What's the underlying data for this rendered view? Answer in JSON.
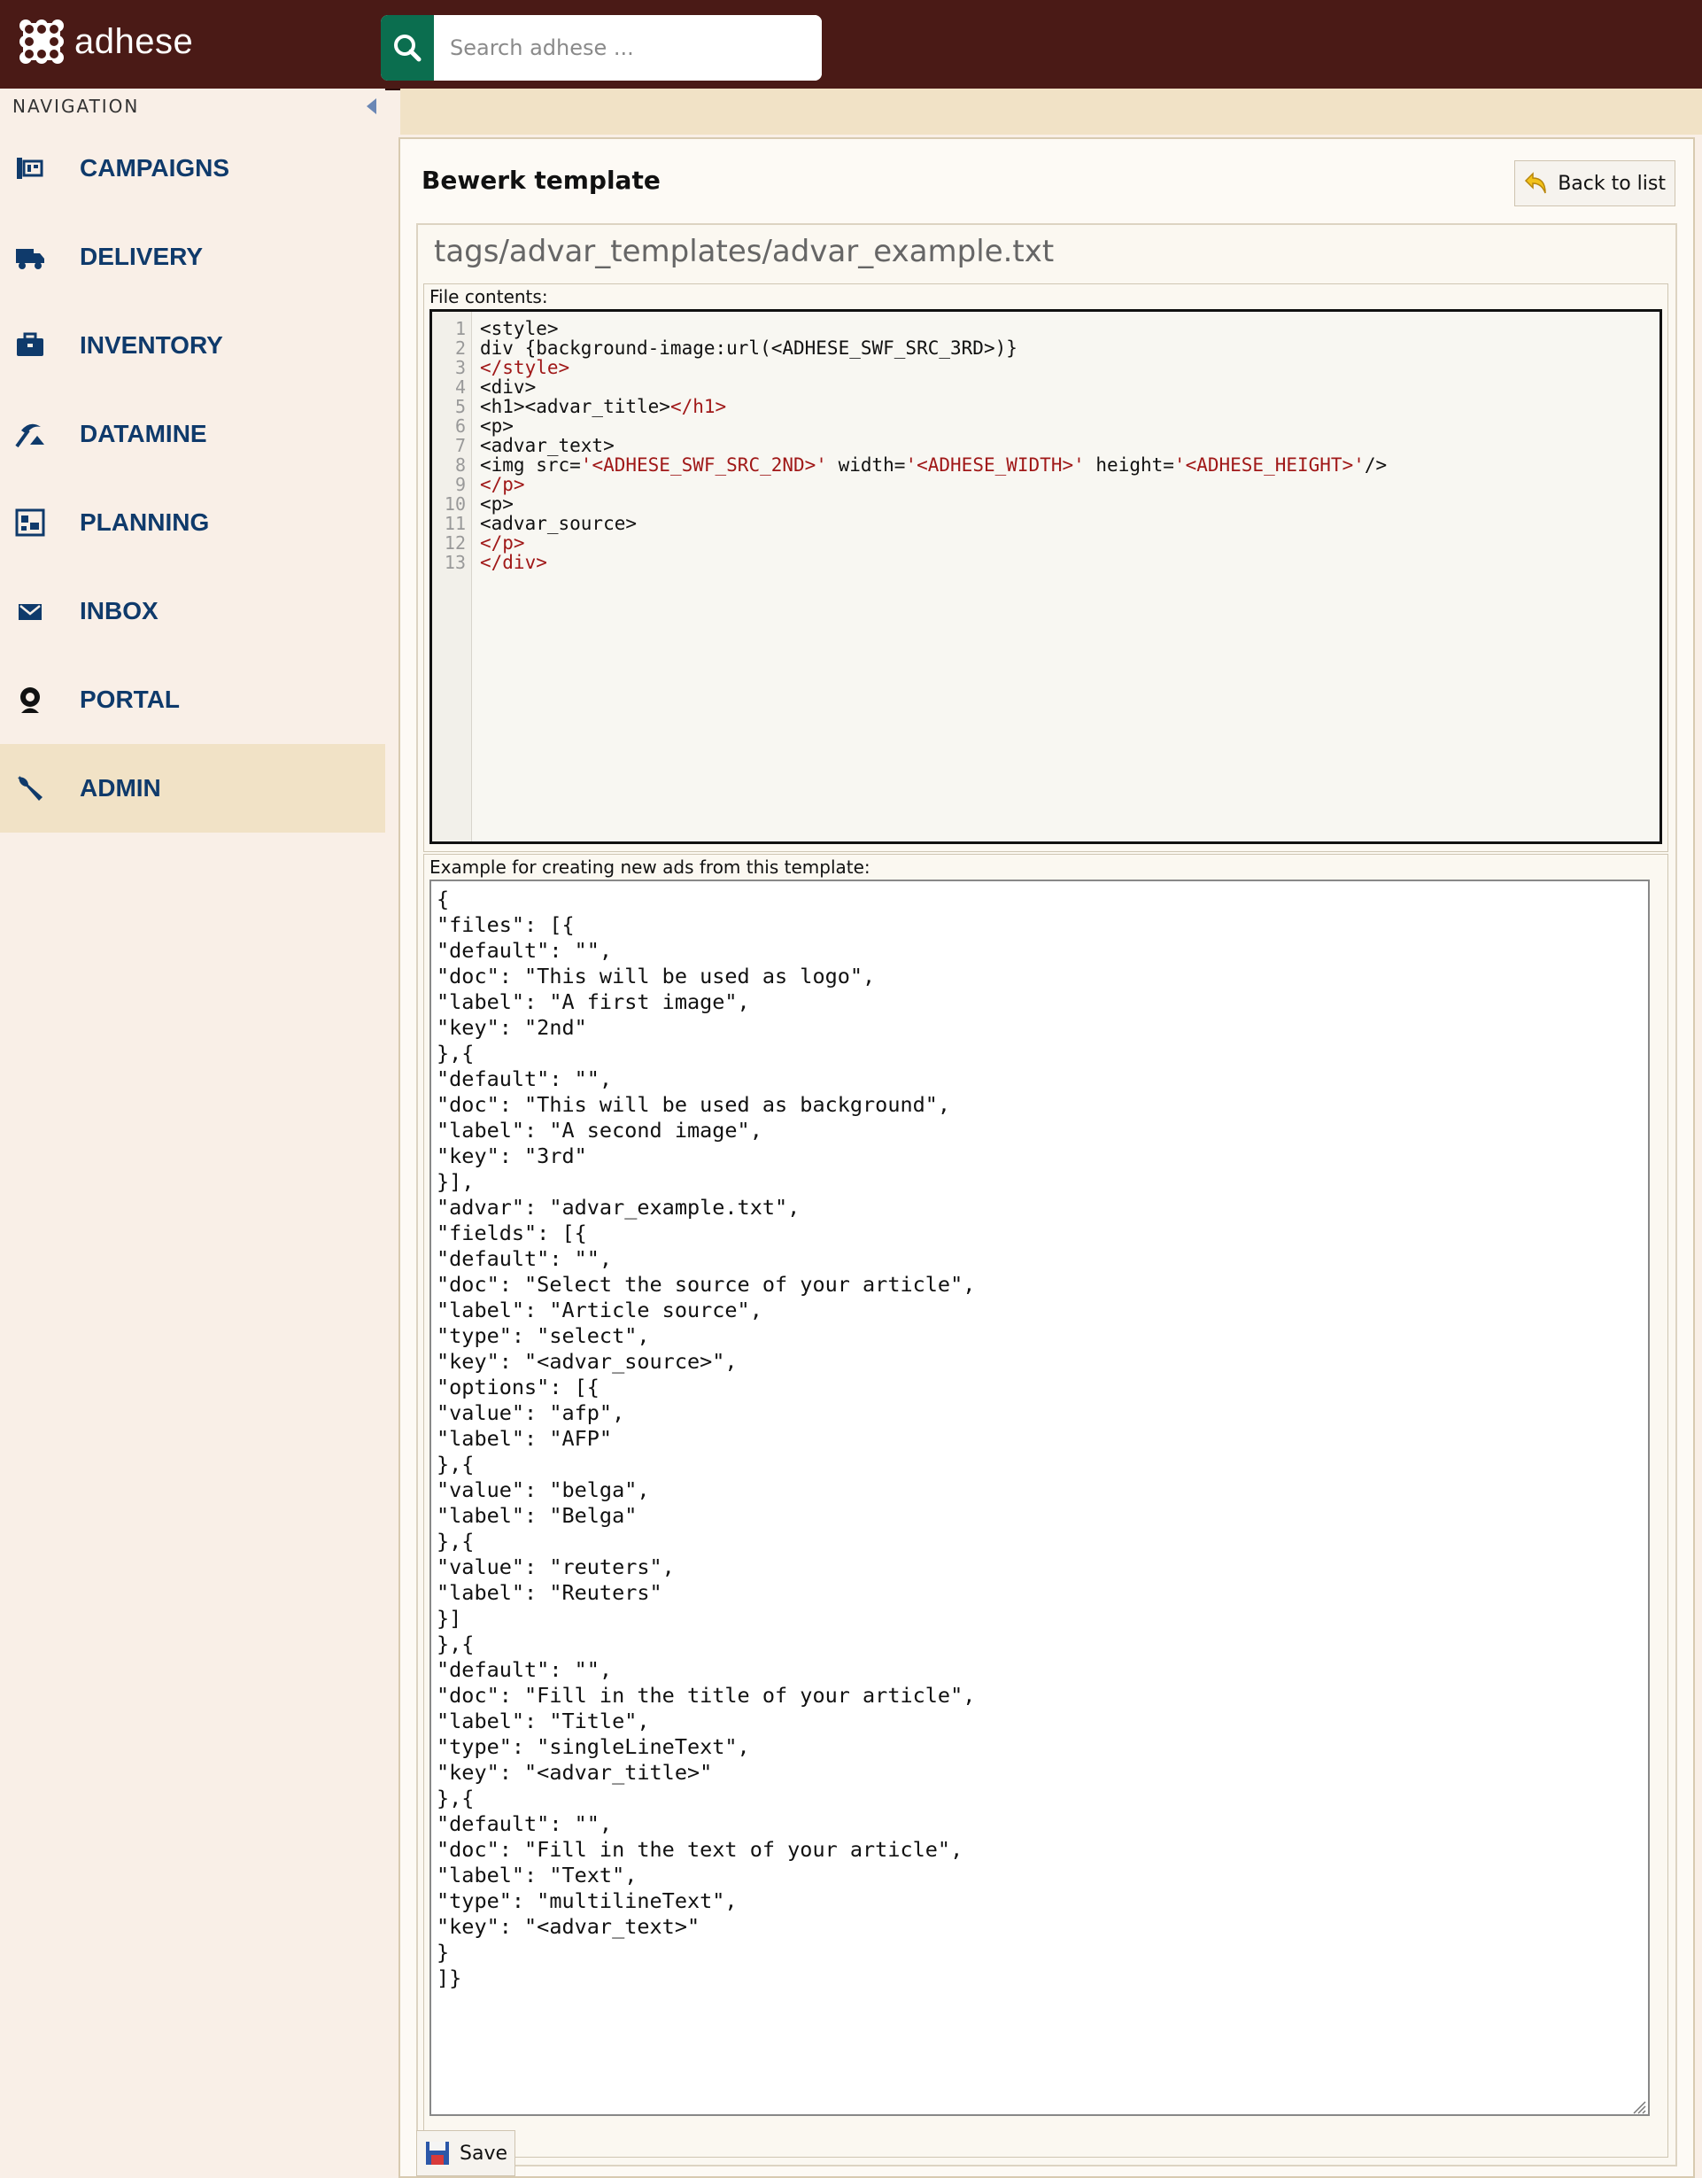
{
  "app": {
    "name": "adhese"
  },
  "search": {
    "placeholder": "Search adhese ..."
  },
  "sidebar": {
    "heading": "NAVIGATION",
    "items": [
      {
        "label": "CAMPAIGNS",
        "icon": "campaigns-icon"
      },
      {
        "label": "DELIVERY",
        "icon": "truck-icon"
      },
      {
        "label": "INVENTORY",
        "icon": "briefcase-icon"
      },
      {
        "label": "DATAMINE",
        "icon": "pickaxe-icon"
      },
      {
        "label": "PLANNING",
        "icon": "planning-icon"
      },
      {
        "label": "INBOX",
        "icon": "mail-icon"
      },
      {
        "label": "PORTAL",
        "icon": "webcam-icon"
      },
      {
        "label": "ADMIN",
        "icon": "wrench-icon",
        "active": true
      }
    ]
  },
  "page": {
    "title": "Bewerk template",
    "back_label": "Back to list",
    "file_path": "tags/advar_templates/advar_example.txt",
    "file_contents_label": "File contents:",
    "example_label": "Example for creating new ads from this template:",
    "save_label": "Save"
  },
  "code": {
    "line_numbers": [
      "1",
      "2",
      "3",
      "4",
      "5",
      "6",
      "7",
      "8",
      "9",
      "10",
      "11",
      "12",
      "13"
    ],
    "l1": "<style>",
    "l2": "div {background-image:url(<ADHESE_SWF_SRC_3RD>)}",
    "l3_tag": "</style>",
    "l4": "<div>",
    "l5a": "<h1><advar_title>",
    "l5b": "</h1>",
    "l6": "<p>",
    "l7": "<advar_text>",
    "l8a": "<img src=",
    "l8b": "'<ADHESE_SWF_SRC_2ND>'",
    "l8c": " width=",
    "l8d": "'<ADHESE_WIDTH>'",
    "l8e": " height=",
    "l8f": "'<ADHESE_HEIGHT>'",
    "l8g": "/>",
    "l9": "</p>",
    "l10": "<p>",
    "l11": "<advar_source>",
    "l12": "</p>",
    "l13": "</div>"
  },
  "example_json": "{\n\"files\": [{\n\"default\": \"\",\n\"doc\": \"This will be used as logo\",\n\"label\": \"A first image\",\n\"key\": \"2nd\"\n},{\n\"default\": \"\",\n\"doc\": \"This will be used as background\",\n\"label\": \"A second image\",\n\"key\": \"3rd\"\n}],\n\"advar\": \"advar_example.txt\",\n\"fields\": [{\n\"default\": \"\",\n\"doc\": \"Select the source of your article\",\n\"label\": \"Article source\",\n\"type\": \"select\",\n\"key\": \"<advar_source>\",\n\"options\": [{\n\"value\": \"afp\",\n\"label\": \"AFP\"\n},{\n\"value\": \"belga\",\n\"label\": \"Belga\"\n},{\n\"value\": \"reuters\",\n\"label\": \"Reuters\"\n}]\n},{\n\"default\": \"\",\n\"doc\": \"Fill in the title of your article\",\n\"label\": \"Title\",\n\"type\": \"singleLineText\",\n\"key\": \"<advar_title>\"\n},{\n\"default\": \"\",\n\"doc\": \"Fill in the text of your article\",\n\"label\": \"Text\",\n\"type\": \"multilineText\",\n\"key\": \"<advar_text>\"\n}\n]}",
  "colors": {
    "header_bg": "#4a1a16",
    "search_button": "#0b6e4f",
    "nav_text": "#0f3a6b",
    "active_bg": "#f1e2c6",
    "code_tag": "#a01818"
  }
}
